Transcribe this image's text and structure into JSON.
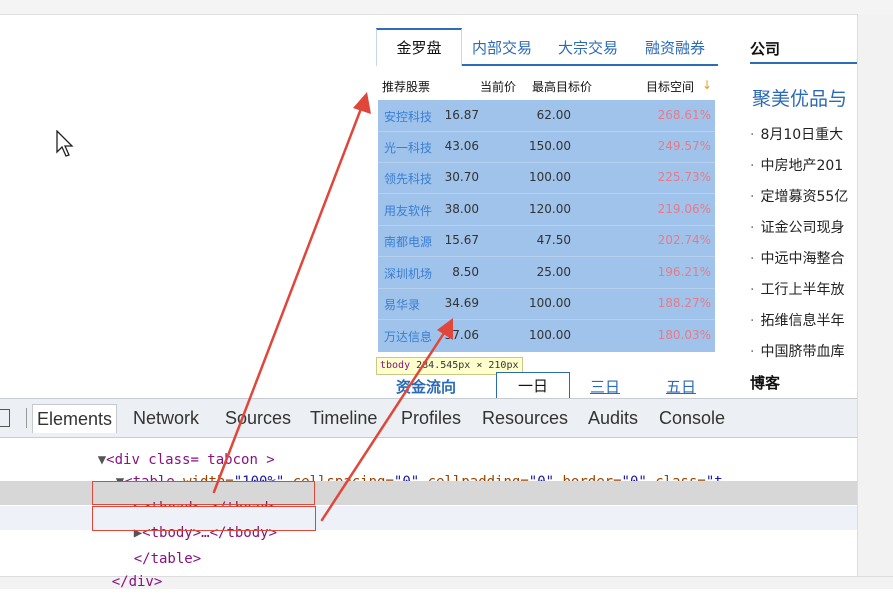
{
  "stock_tabs": {
    "tabs": [
      "金罗盘",
      "内部交易",
      "大宗交易",
      "融资融券"
    ],
    "active": "金罗盘"
  },
  "table": {
    "headers": {
      "name": "推荐股票",
      "price": "当前价",
      "target": "最高目标价",
      "space": "目标空间"
    },
    "rows": [
      {
        "name": "安控科技",
        "price": "16.87",
        "target": "62.00",
        "space": "268.61%"
      },
      {
        "name": "光一科技",
        "price": "43.06",
        "target": "150.00",
        "space": "249.57%"
      },
      {
        "name": "领先科技",
        "price": "30.70",
        "target": "100.00",
        "space": "225.73%"
      },
      {
        "name": "用友软件",
        "price": "38.00",
        "target": "120.00",
        "space": "219.06%"
      },
      {
        "name": "南都电源",
        "price": "15.67",
        "target": "47.50",
        "space": "202.74%"
      },
      {
        "name": "深圳机场",
        "price": "8.50",
        "target": "25.00",
        "space": "196.21%"
      },
      {
        "name": "易华录",
        "price": "34.69",
        "target": "100.00",
        "space": "188.27%"
      },
      {
        "name": "万达信息",
        "price": "37.06",
        "target": "100.00",
        "space": "180.03%"
      }
    ]
  },
  "tooltip": {
    "tag": "tbody",
    "size": "284.545px × 210px"
  },
  "subtabs": {
    "flow": "资金流向",
    "day1": "一日",
    "day3": "三日",
    "day5": "五日"
  },
  "right_panel": {
    "title": "公司",
    "headline": "聚美优品与",
    "news": [
      "8月10日重大",
      "中房地产201",
      "定增募资55亿",
      "证金公司现身",
      "中远中海整合",
      "工行上半年放",
      "拓维信息半年",
      "中国脐带血库"
    ],
    "blog_title": "博客"
  },
  "devtools": {
    "tabs": [
      "Elements",
      "Network",
      "Sources",
      "Timeline",
      "Profiles",
      "Resources",
      "Audits",
      "Console"
    ],
    "active_tab": "Elements",
    "dom": {
      "line1": "<div class= tabcon >",
      "table_tag": "<table",
      "width_attr": " width=",
      "width_val": "\"100%\"",
      "cellspacing_attr": " cellspacing=",
      "cellspacing_val": "\"0\"",
      "cellpadding_attr": " cellpadding=",
      "cellpadding_val": "\"0\"",
      "border_attr": " border=",
      "border_val": "\"0\"",
      "class_attr": " class=",
      "class_val": "\"t",
      "thead": "<thead>…</thead>",
      "tbody": "<tbody>…</tbody>",
      "table_close": "</table>",
      "div_close": "</div>"
    }
  },
  "colors": {
    "accent": "#2d6cb8",
    "selection": "#9fc3ea",
    "annotation": "#e0463a"
  }
}
